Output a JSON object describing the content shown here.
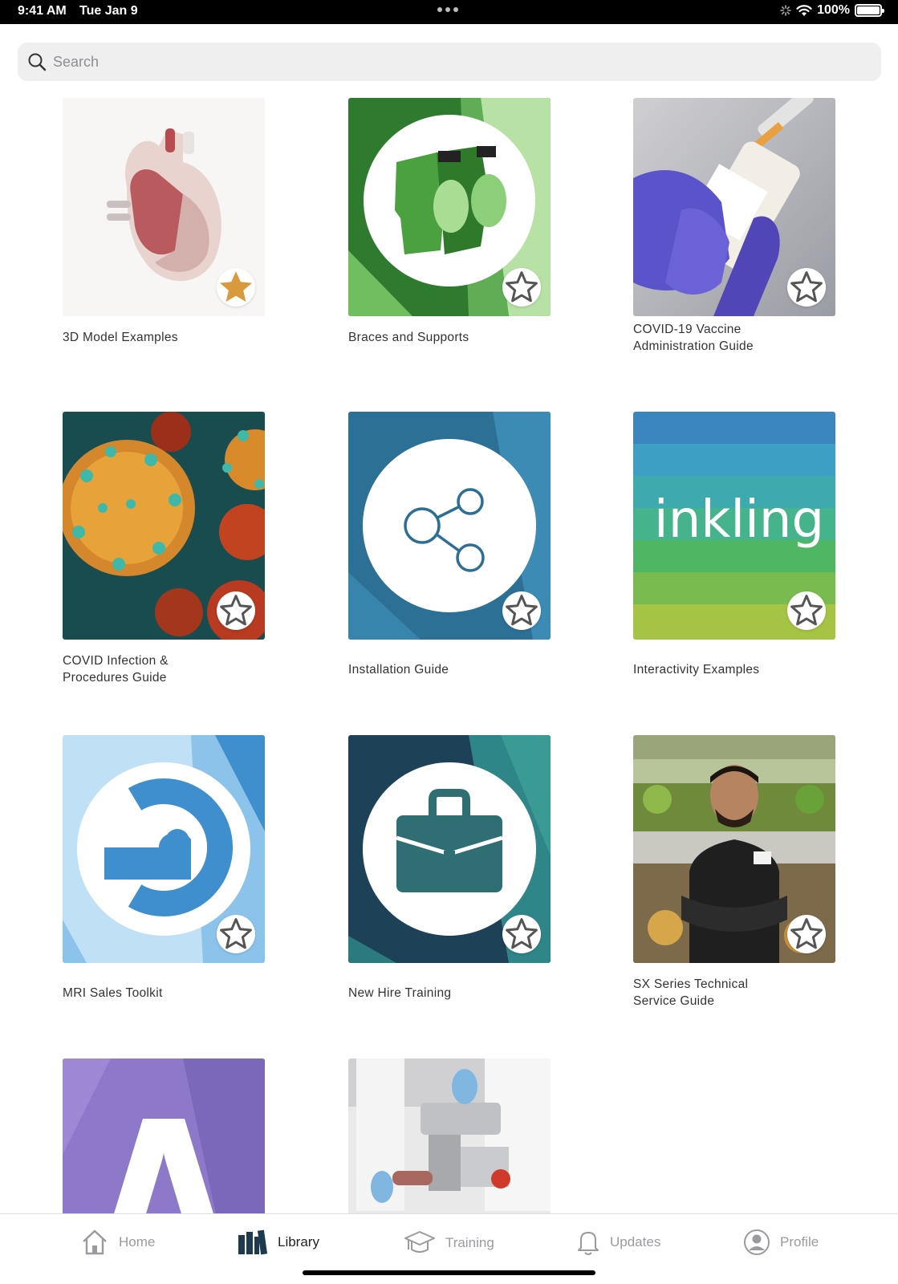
{
  "status_bar": {
    "time": "9:41 AM",
    "date": "Tue Jan 9",
    "battery": "100%"
  },
  "search": {
    "placeholder": "Search"
  },
  "books": [
    {
      "title_lines": [
        "3D Model Examples"
      ],
      "favorited": true,
      "cover": "heart-3d"
    },
    {
      "title_lines": [
        "Braces and Supports"
      ],
      "favorited": false,
      "cover": "braces-icon"
    },
    {
      "title_lines": [
        "COVID-19  Vaccine",
        "Administration Guide"
      ],
      "favorited": false,
      "cover": "vaccine-photo"
    },
    {
      "title_lines": [
        "COVID Infection &",
        "Procedures Guide"
      ],
      "favorited": false,
      "cover": "virus-photo"
    },
    {
      "title_lines": [
        "Installation Guide"
      ],
      "favorited": false,
      "cover": "share-icon"
    },
    {
      "title_lines": [
        "Interactivity Examples"
      ],
      "favorited": false,
      "cover": "inkling-logo",
      "cover_text": "inkling"
    },
    {
      "title_lines": [
        "MRI Sales Toolkit"
      ],
      "favorited": false,
      "cover": "mri-icon"
    },
    {
      "title_lines": [
        "New Hire Training"
      ],
      "favorited": false,
      "cover": "briefcase-icon"
    },
    {
      "title_lines": [
        "SX Series Technical",
        "Service Guide"
      ],
      "favorited": false,
      "cover": "grocer-photo"
    },
    {
      "title_lines": [
        ""
      ],
      "favorited": false,
      "cover": "letter-a-icon"
    },
    {
      "title_lines": [
        ""
      ],
      "favorited": false,
      "cover": "grinder-photo"
    }
  ],
  "tab_bar": {
    "items": [
      {
        "label": "Home",
        "icon": "home-icon",
        "active": false
      },
      {
        "label": "Library",
        "icon": "library-icon",
        "active": true
      },
      {
        "label": "Training",
        "icon": "graduation-cap-icon",
        "active": false
      },
      {
        "label": "Updates",
        "icon": "bell-icon",
        "active": false
      },
      {
        "label": "Profile",
        "icon": "profile-icon",
        "active": false
      }
    ]
  },
  "colors": {
    "favorite_active": "#d99a3e",
    "favorite_inactive": "#555555",
    "tab_inactive": "#9a9aa0"
  }
}
